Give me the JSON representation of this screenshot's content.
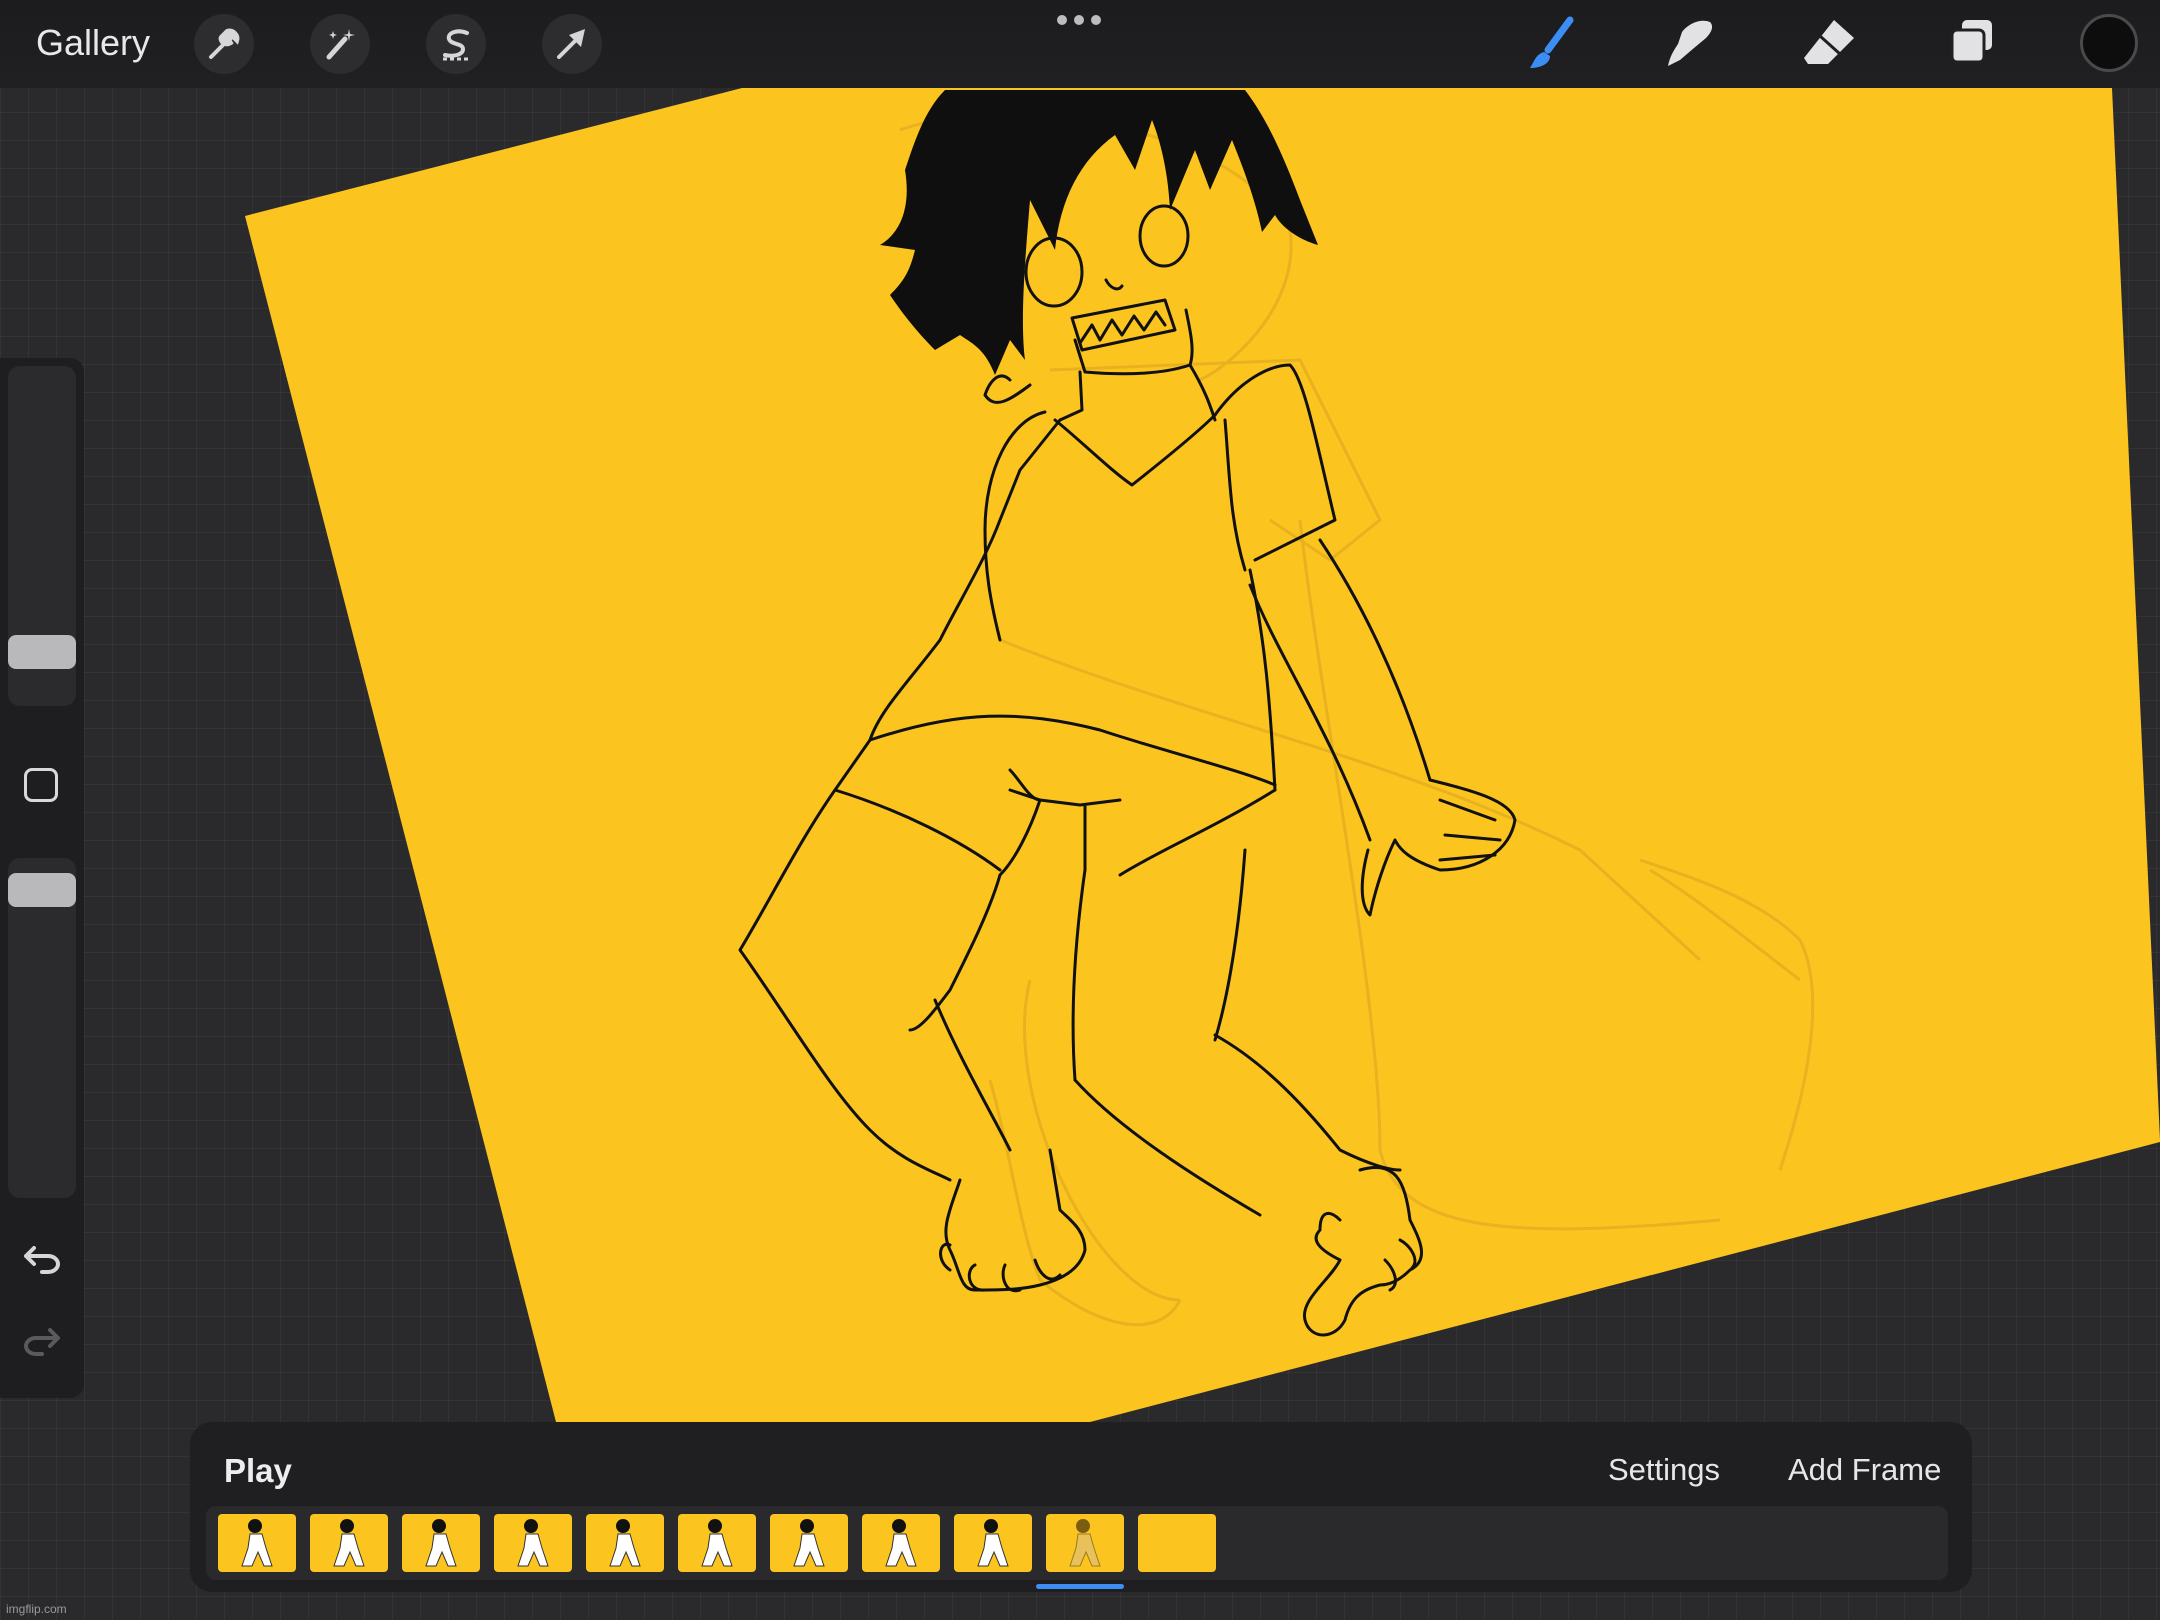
{
  "topbar": {
    "gallery_label": "Gallery",
    "left_tools": [
      {
        "name": "actions",
        "icon": "wrench-icon"
      },
      {
        "name": "adjustments",
        "icon": "magic-wand-icon"
      },
      {
        "name": "selection",
        "icon": "selection-s-icon"
      },
      {
        "name": "transform",
        "icon": "arrow-cursor-icon"
      }
    ],
    "right_tools": [
      {
        "name": "brush",
        "icon": "brush-icon",
        "active": true
      },
      {
        "name": "smudge",
        "icon": "smudge-finger-icon",
        "active": false
      },
      {
        "name": "eraser",
        "icon": "eraser-icon",
        "active": false
      },
      {
        "name": "layers",
        "icon": "layers-icon",
        "active": false
      }
    ],
    "more_icon": "more-dots-icon",
    "current_color": "#0d0d0d"
  },
  "canvas": {
    "background_color": "#fcc41f",
    "line_color": "#111111"
  },
  "sidebar": {
    "brush_size_level": 0.12,
    "opacity_level": 0.95,
    "undo_icon": "undo-arrow-icon",
    "redo_icon": "redo-arrow-icon"
  },
  "animation": {
    "play_label": "Play",
    "settings_label": "Settings",
    "add_frame_label": "Add Frame",
    "frames_count": 11,
    "selected_frame_index": 9
  },
  "watermark": "imgflip.com",
  "colors": {
    "accent": "#3d8ef4",
    "panel": "#1f1f21"
  }
}
